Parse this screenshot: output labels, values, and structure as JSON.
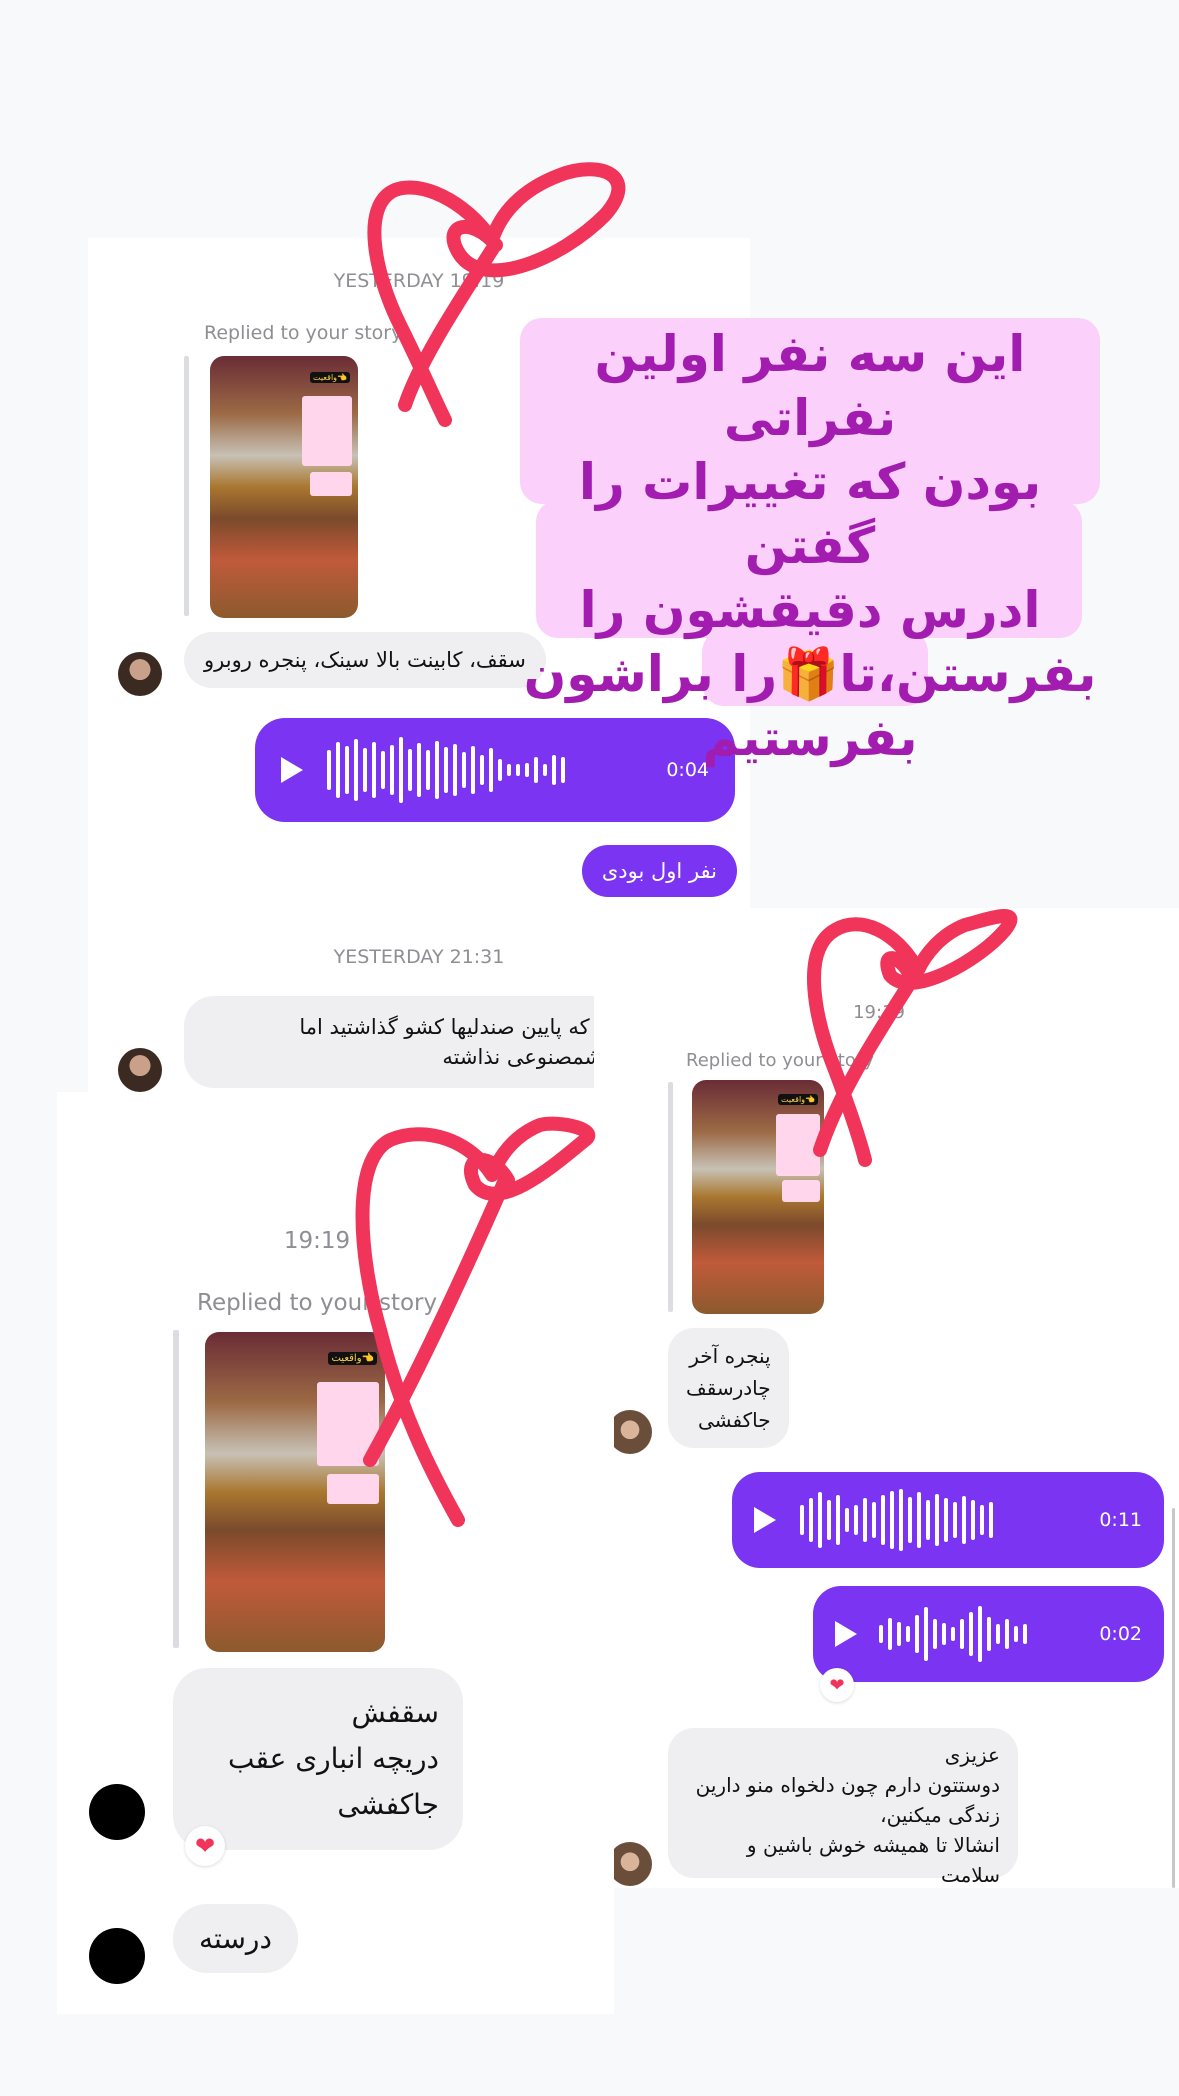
{
  "card1": {
    "timestamp1": "YESTERDAY 19:19",
    "replied": "Replied to your story",
    "message1": "سقف، کابینت بالا سینک، پنجره روبرو",
    "voice1_duration": "0:04",
    "sent1": "نفر اول بودی",
    "timestamp2": "YESTERDAY 21:31",
    "message2_line1": "این که پایین صندلیها کشو گذاشتید اما",
    "message2_line2": "هوشمصنوعی نذاشته"
  },
  "card2": {
    "timestamp": "19:19",
    "replied": "Replied to your story",
    "message1_lines": [
      "پنجره آخر",
      "چادرسقف",
      "جاکفشی"
    ],
    "voice1_duration": "0:11",
    "voice2_duration": "0:02",
    "message2_lines": [
      "عزیزی",
      "دوستتون دارم چون دلخواه منو دارین",
      "زندگی میکنین،",
      "انشالا تا همیشه خوش باشین و سلامت"
    ]
  },
  "card3": {
    "timestamp": "19:19",
    "replied": "Replied to your story",
    "message1_lines": [
      "سقفش",
      "دریچه انباری عقب",
      "جاکفشی"
    ],
    "message2": "درسته"
  },
  "story_thumb": {
    "tag": "واقعیت👈",
    "sticker1": "چندچرچرمی‌شی ۳ماه پیش گفت کجوری‌ون اینجوری میشه تفاوتوشون کجاهاست؟",
    "sticker2": "هرکی۳تاشا گفت🎁داره"
  },
  "overlay": {
    "line1": "این سه نفر اولین نفراتی",
    "line2": "بودن که تغییرات را گفتن",
    "line3": "ادرس دقیقشون را",
    "line4": "بفرستن،تا🎁را براشون",
    "line5": "بفرستیم"
  },
  "colors": {
    "accent": "#7a34f2",
    "heart": "#f0345a",
    "overlay_text": "#a21caf",
    "overlay_bg": "#fbd0fb",
    "incoming_bubble": "#efeff1"
  },
  "icons": [
    "play-icon",
    "heart-reaction-icon",
    "heart-drawing"
  ]
}
